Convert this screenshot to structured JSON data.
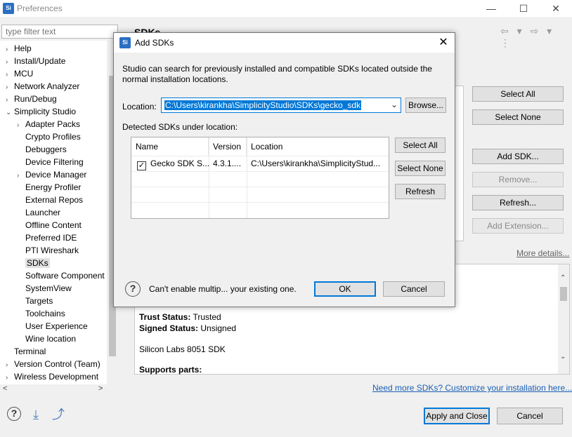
{
  "window": {
    "logo": "Si",
    "title": "Preferences",
    "minimize": "—",
    "maximize": "☐",
    "close": "✕"
  },
  "left": {
    "filter_placeholder": "type filter text",
    "tree": [
      {
        "label": "Help",
        "arrow": "›",
        "indent": 0
      },
      {
        "label": "Install/Update",
        "arrow": "›",
        "indent": 0
      },
      {
        "label": "MCU",
        "arrow": "›",
        "indent": 0
      },
      {
        "label": "Network Analyzer",
        "arrow": "›",
        "indent": 0
      },
      {
        "label": "Run/Debug",
        "arrow": "›",
        "indent": 0
      },
      {
        "label": "Simplicity Studio",
        "arrow": "⌄",
        "indent": 0
      },
      {
        "label": "Adapter Packs",
        "arrow": "›",
        "indent": 1
      },
      {
        "label": "Crypto Profiles",
        "arrow": "",
        "indent": 1
      },
      {
        "label": "Debuggers",
        "arrow": "",
        "indent": 1
      },
      {
        "label": "Device Filtering",
        "arrow": "",
        "indent": 1
      },
      {
        "label": "Device Manager",
        "arrow": "›",
        "indent": 1
      },
      {
        "label": "Energy Profiler",
        "arrow": "",
        "indent": 1
      },
      {
        "label": "External Repos",
        "arrow": "",
        "indent": 1
      },
      {
        "label": "Launcher",
        "arrow": "",
        "indent": 1
      },
      {
        "label": "Offline Content",
        "arrow": "",
        "indent": 1
      },
      {
        "label": "Preferred IDE",
        "arrow": "",
        "indent": 1
      },
      {
        "label": "PTI Wireshark",
        "arrow": "",
        "indent": 1
      },
      {
        "label": "SDKs",
        "arrow": "",
        "indent": 1,
        "selected": true
      },
      {
        "label": "Software Component",
        "arrow": "",
        "indent": 1
      },
      {
        "label": "SystemView",
        "arrow": "",
        "indent": 1
      },
      {
        "label": "Targets",
        "arrow": "",
        "indent": 1
      },
      {
        "label": "Toolchains",
        "arrow": "",
        "indent": 1
      },
      {
        "label": "User Experience",
        "arrow": "",
        "indent": 1
      },
      {
        "label": "Wine location",
        "arrow": "",
        "indent": 1
      },
      {
        "label": "Terminal",
        "arrow": "",
        "indent": 0
      },
      {
        "label": "Version Control (Team)",
        "arrow": "›",
        "indent": 0
      },
      {
        "label": "Wireless Development",
        "arrow": "›",
        "indent": 0
      }
    ]
  },
  "right": {
    "title": "SDKs",
    "nav_icons": "⇦ ▾ ⇨ ▾ ⋮",
    "buttons": {
      "select_all": "Select All",
      "select_none": "Select None",
      "add_sdk": "Add SDK...",
      "remove": "Remove...",
      "refresh": "Refresh...",
      "add_extension": "Add Extension..."
    },
    "more_details": "More details...",
    "details": {
      "trust_label": "Trust Status:",
      "trust_value": " Trusted",
      "signed_label": "Signed Status:",
      "signed_value": " Unsigned",
      "sdk_name": "Silicon Labs 8051 SDK",
      "supports": "Supports parts:",
      "scroll_up": "⌃",
      "scroll_down": "⌄"
    },
    "need_more": "Need more SDKs?  Customize your installation here..."
  },
  "bottom": {
    "help": "?",
    "import_icon": "⤓",
    "export_icon": "⤴",
    "apply_close": "Apply and Close",
    "cancel": "Cancel"
  },
  "dialog": {
    "logo": "Si",
    "title": "Add SDKs",
    "close": "✕",
    "description": "Studio can search for previously installed and compatible SDKs located outside the normal installation locations.",
    "location_label": "Location:",
    "location_value": "C:\\Users\\kirankha\\SimplicityStudio\\SDKs\\gecko_sdk",
    "location_chevron": "⌄",
    "browse": "Browse...",
    "detected_label": "Detected SDKs under location:",
    "columns": {
      "name": "Name",
      "version": "Version",
      "location": "Location"
    },
    "rows": [
      {
        "checked": "✓",
        "name": "Gecko SDK S...",
        "version": "4.3.1....",
        "location": "C:\\Users\\kirankha\\SimplicityStud..."
      }
    ],
    "select_all": "Select All",
    "select_none": "Select None",
    "refresh": "Refresh",
    "help": "?",
    "message": "Can't enable multip... your existing one.",
    "ok": "OK",
    "cancel": "Cancel"
  }
}
